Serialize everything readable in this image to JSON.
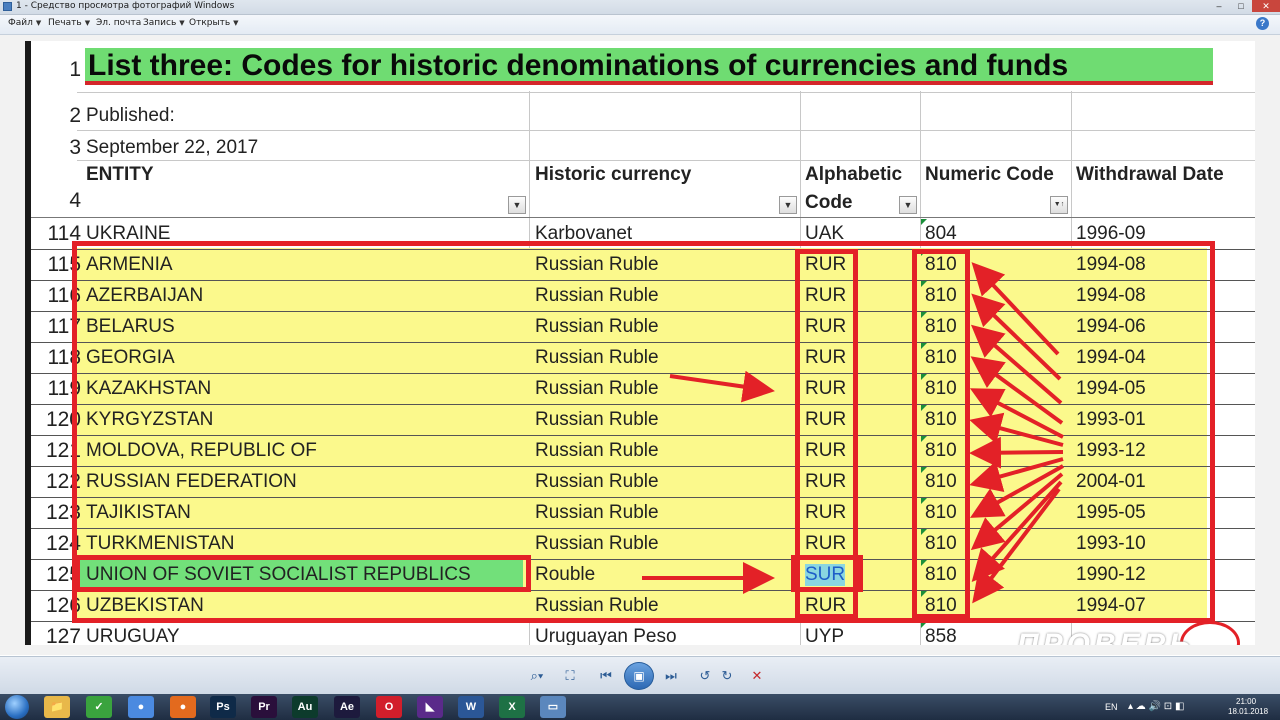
{
  "window": {
    "title": "1 - Средство просмотра фотографий Windows",
    "minimize": "–",
    "maximize": "□",
    "close": "✕"
  },
  "menu": [
    {
      "label": "Файл"
    },
    {
      "label": "Печать"
    },
    {
      "label": "Эл. почта"
    },
    {
      "label": "Запись"
    },
    {
      "label": "Открыть"
    }
  ],
  "help_icon": "?",
  "sheet": {
    "title": "List three: Codes for historic denominations of currencies and funds",
    "published_label": "Published:",
    "published_date": "September 22, 2017",
    "header_row_num": "4",
    "title_row_num": "1",
    "published_row_num": "2",
    "date_row_num": "3",
    "headers": {
      "entity": "ENTITY",
      "historic_currency": "Historic currency",
      "alpha_line1": "Alphabetic",
      "alpha_line2": "Code",
      "numeric": "Numeric Code",
      "withdrawal": "Withdrawal Date"
    },
    "filter_glyphs": {
      "dropdown": "▼",
      "sorted": "▼↑"
    },
    "rows": [
      {
        "num": "114",
        "entity": "UKRAINE",
        "currency": "Karbovanet",
        "alpha": "UAK",
        "numeric": "804",
        "date": "1996-09"
      },
      {
        "num": "115",
        "entity": "ARMENIA",
        "currency": "Russian Ruble",
        "alpha": "RUR",
        "numeric": "810",
        "date": "1994-08"
      },
      {
        "num": "116",
        "entity": "AZERBAIJAN",
        "currency": "Russian Ruble",
        "alpha": "RUR",
        "numeric": "810",
        "date": "1994-08"
      },
      {
        "num": "117",
        "entity": "BELARUS",
        "currency": "Russian Ruble",
        "alpha": "RUR",
        "numeric": "810",
        "date": "1994-06"
      },
      {
        "num": "118",
        "entity": "GEORGIA",
        "currency": "Russian Ruble",
        "alpha": "RUR",
        "numeric": "810",
        "date": "1994-04"
      },
      {
        "num": "119",
        "entity": "KAZAKHSTAN",
        "currency": "Russian Ruble",
        "alpha": "RUR",
        "numeric": "810",
        "date": "1994-05"
      },
      {
        "num": "120",
        "entity": "KYRGYZSTAN",
        "currency": "Russian Ruble",
        "alpha": "RUR",
        "numeric": "810",
        "date": "1993-01"
      },
      {
        "num": "121",
        "entity": "MOLDOVA, REPUBLIC OF",
        "currency": "Russian Ruble",
        "alpha": "RUR",
        "numeric": "810",
        "date": "1993-12"
      },
      {
        "num": "122",
        "entity": "RUSSIAN FEDERATION",
        "currency": "Russian Ruble",
        "alpha": "RUR",
        "numeric": "810",
        "date": "2004-01"
      },
      {
        "num": "123",
        "entity": "TAJIKISTAN",
        "currency": "Russian Ruble",
        "alpha": "RUR",
        "numeric": "810",
        "date": "1995-05"
      },
      {
        "num": "124",
        "entity": "TURKMENISTAN",
        "currency": "Russian Ruble",
        "alpha": "RUR",
        "numeric": "810",
        "date": "1993-10"
      },
      {
        "num": "125",
        "entity": "UNION OF SOVIET SOCIALIST REPUBLICS",
        "currency": "Rouble",
        "alpha": "SUR",
        "numeric": "810",
        "date": "1990-12"
      },
      {
        "num": "126",
        "entity": "UZBEKISTAN",
        "currency": "Russian Ruble",
        "alpha": "RUR",
        "numeric": "810",
        "date": "1994-07"
      },
      {
        "num": "127",
        "entity": "URUGUAY",
        "currency": "Uruguayan Peso",
        "alpha": "UYP",
        "numeric": "858",
        "date": ""
      }
    ]
  },
  "watermark": "ПРОВЕRЬ",
  "toolbar": {
    "zoom": "⌕▾",
    "fit": "⛶",
    "prev": "⏮",
    "slideshow": "▣",
    "next": "⏭",
    "rotate_ccw": "↺",
    "rotate_cw": "↻",
    "delete": "✕"
  },
  "taskbar": {
    "apps": [
      {
        "name": "explorer",
        "label": "📁",
        "color": "#e8b84a"
      },
      {
        "name": "app-green",
        "label": "✓",
        "color": "#3aa33e"
      },
      {
        "name": "chrome",
        "label": "●",
        "color": "#4b8ae0"
      },
      {
        "name": "firefox",
        "label": "●",
        "color": "#e36a1e"
      },
      {
        "name": "photoshop",
        "label": "Ps",
        "color": "#0f2a48"
      },
      {
        "name": "premiere",
        "label": "Pr",
        "color": "#2a0f3b"
      },
      {
        "name": "audition",
        "label": "Au",
        "color": "#0d3b2c"
      },
      {
        "name": "aftereffects",
        "label": "Ae",
        "color": "#1d1a3d"
      },
      {
        "name": "opera",
        "label": "O",
        "color": "#d21e2b"
      },
      {
        "name": "app-purple",
        "label": "◣",
        "color": "#5a2a8a"
      },
      {
        "name": "word",
        "label": "W",
        "color": "#2b5797"
      },
      {
        "name": "excel",
        "label": "X",
        "color": "#1e7145"
      },
      {
        "name": "photoviewer",
        "label": "▭",
        "color": "#5b87bd"
      }
    ],
    "lang": "EN",
    "time": "21:00",
    "date": "18.01.2018"
  }
}
